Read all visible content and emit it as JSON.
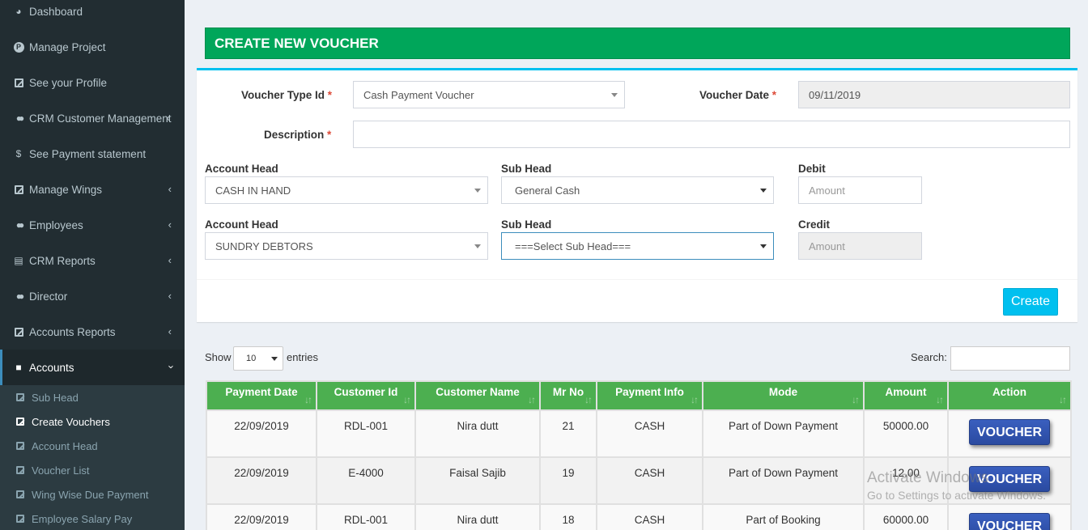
{
  "sidebar": {
    "items": [
      {
        "label": "Dashboard",
        "icon": "dashboard-icon"
      },
      {
        "label": "Manage Project",
        "icon": "p-circle-icon"
      },
      {
        "label": "See your Profile",
        "icon": "edit-icon"
      },
      {
        "label": "CRM Customer Management",
        "icon": "users-icon"
      },
      {
        "label": "See Payment statement",
        "icon": "dollar-icon"
      },
      {
        "label": "Manage Wings",
        "icon": "edit-icon"
      },
      {
        "label": "Employees",
        "icon": "users-icon"
      },
      {
        "label": "CRM Reports",
        "icon": "book-icon"
      },
      {
        "label": "Director",
        "icon": "users-icon"
      },
      {
        "label": "Accounts Reports",
        "icon": "edit-icon"
      },
      {
        "label": "Accounts",
        "icon": "folder-icon"
      }
    ],
    "sub_items": [
      {
        "label": "Sub Head"
      },
      {
        "label": "Create Vouchers"
      },
      {
        "label": "Account Head"
      },
      {
        "label": "Voucher List"
      },
      {
        "label": "Wing Wise Due Payment"
      },
      {
        "label": "Employee Salary Pay"
      }
    ]
  },
  "header": {
    "title": "CREATE NEW VOUCHER"
  },
  "form": {
    "voucher_type_label": "Voucher Type Id",
    "voucher_type_value": "Cash Payment Voucher",
    "voucher_date_label": "Voucher Date",
    "voucher_date_value": "09/11/2019",
    "description_label": "Description",
    "description_value": "",
    "required_mark": "*",
    "row1": {
      "account_head_label": "Account Head",
      "account_head_value": "CASH IN HAND",
      "sub_head_label": "Sub Head",
      "sub_head_value": "General Cash",
      "amount_label": "Debit",
      "amount_placeholder": "Amount"
    },
    "row2": {
      "account_head_label": "Account Head",
      "account_head_value": "SUNDRY DEBTORS",
      "sub_head_label": "Sub Head",
      "sub_head_value": "===Select Sub Head===",
      "amount_label": "Credit",
      "amount_placeholder": "Amount"
    },
    "create_label": "Create"
  },
  "table_controls": {
    "show_label": "Show",
    "length_value": "10",
    "entries_label": "entries",
    "search_label": "Search:"
  },
  "table": {
    "headers": [
      "Payment Date",
      "Customer Id",
      "Customer Name",
      "Mr No",
      "Payment Info",
      "Mode",
      "Amount",
      "Action"
    ],
    "rows": [
      {
        "date": "22/09/2019",
        "customer_id": "RDL-001",
        "customer_name": "Nira dutt",
        "mr_no": "21",
        "info": "CASH",
        "mode": "Part of Down Payment",
        "amount": "50000.00",
        "action": "VOUCHER"
      },
      {
        "date": "22/09/2019",
        "customer_id": "E-4000",
        "customer_name": "Faisal Sajib",
        "mr_no": "19",
        "info": "CASH",
        "mode": "Part of Down Payment",
        "amount": "12.00",
        "action": "VOUCHER"
      },
      {
        "date": "22/09/2019",
        "customer_id": "RDL-001",
        "customer_name": "Nira dutt",
        "mr_no": "18",
        "info": "CASH",
        "mode": "Part of Booking",
        "amount": "60000.00",
        "action": "VOUCHER"
      }
    ]
  },
  "watermark": {
    "line1": "Activate Windows",
    "line2": "Go to Settings to activate Windows."
  },
  "colors": {
    "sidebar": "#222d32",
    "header_green": "#00a65a",
    "table_header": "#4caf50",
    "create_button": "#00c0ef",
    "voucher_button": "#2f52ad"
  }
}
